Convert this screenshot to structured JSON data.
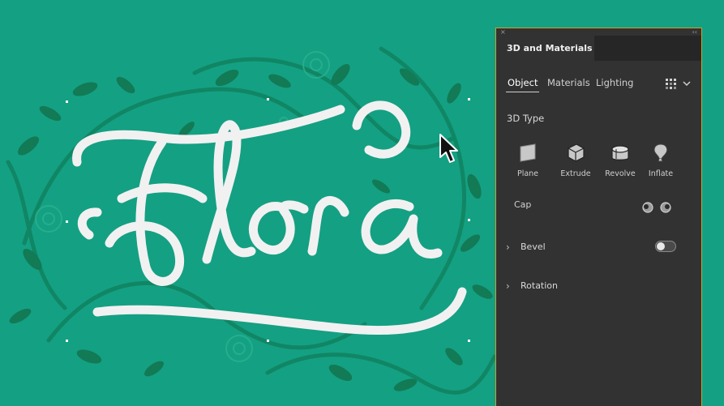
{
  "artwork": {
    "text": "Flora",
    "colors": {
      "background": "#14a083",
      "lettering": "#f1f1f1",
      "leaves": "#127a55",
      "flowers": "#2bb28f"
    }
  },
  "panel": {
    "close_icon": "×",
    "collapse_icon": "‹‹",
    "title": "3D and Materials",
    "tabs": [
      "Object",
      "Materials",
      "Lighting"
    ],
    "active_tab": "Object",
    "render_quality_icon": "quality-grid-icon",
    "section_3d_type": "3D Type",
    "types": [
      {
        "label": "Plane",
        "icon": "plane-icon"
      },
      {
        "label": "Extrude",
        "icon": "extrude-icon"
      },
      {
        "label": "Revolve",
        "icon": "revolve-icon"
      },
      {
        "label": "Inflate",
        "icon": "inflate-icon"
      }
    ],
    "cap_label": "Cap",
    "bevel_label": "Bevel",
    "bevel_enabled": false,
    "rotation_label": "Rotation",
    "chevron": "›",
    "colors": {
      "panel_bg": "#323232",
      "tab_bar": "#262626",
      "frame": "#c9a227"
    }
  }
}
